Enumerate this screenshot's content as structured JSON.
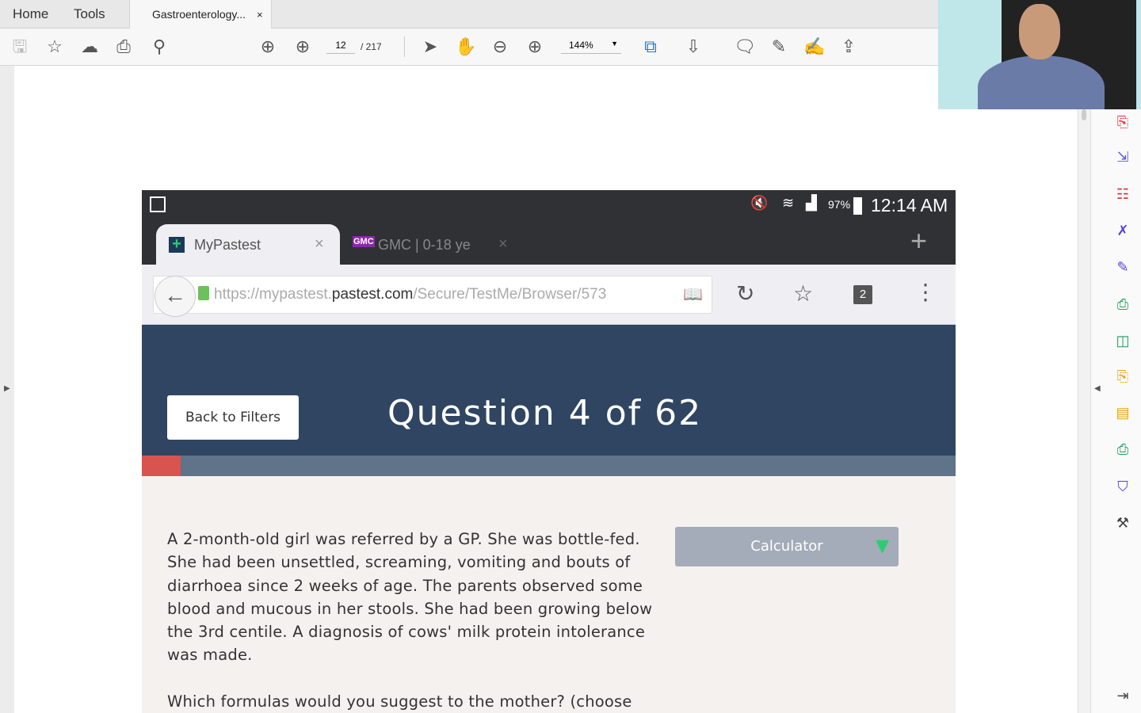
{
  "app": {
    "tabs": [
      "Home",
      "Tools"
    ],
    "doc_tab": "Gastroenterology...",
    "close": "×"
  },
  "toolbar": {
    "page_current": "12",
    "page_total": "/ 217",
    "zoom": "144%"
  },
  "phone": {
    "status": {
      "battery": "97%",
      "time": "12:14 AM"
    },
    "tabs": [
      {
        "label": "MyPastest",
        "close": "×"
      },
      {
        "label": "GMC | 0-18 ye",
        "close": "×",
        "favicon": "GMC"
      }
    ],
    "new_tab": "+",
    "url": {
      "pre": "https://mypastest.",
      "domain": "pastest.com",
      "post": "/Secure/TestMe/Browser/573"
    },
    "tab_count": "2",
    "back_button": "Back to Filters",
    "question_title": "Question 4 of 62",
    "progress_fraction": 0.048,
    "question_text": "A 2-month-old girl was referred by a GP. She was bottle-fed. She had been unsettled, screaming, vomiting and bouts of diarrhoea since 2 weeks of age. The parents observed some blood and mucous in her stools. She had been growing below the 3rd centile. A diagnosis of cows' milk protein intolerance was made.",
    "question_prompt": "Which formulas would you suggest to the mother? (choose",
    "calculator": "Calculator"
  },
  "colors": {
    "header": "#2f4562",
    "progress_red": "#d9534f",
    "accent_green": "#2ecc71"
  }
}
